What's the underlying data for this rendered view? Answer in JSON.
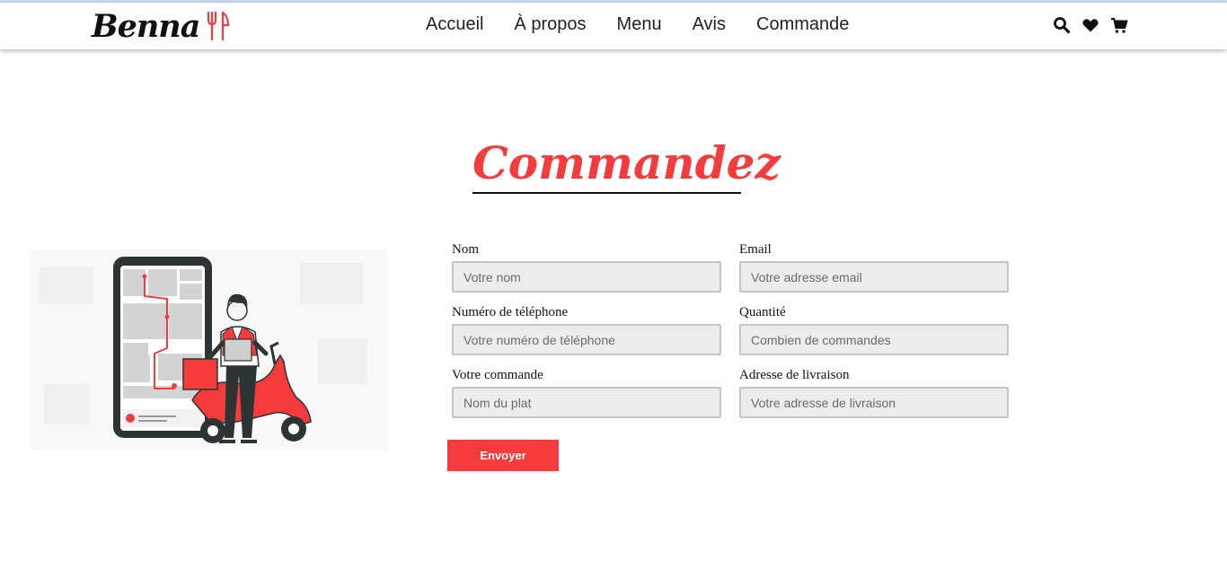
{
  "brand": {
    "name": "Benna",
    "logo_icon": "utensils-icon",
    "accent_color": "#f53b3b"
  },
  "nav": {
    "items": [
      {
        "label": "Accueil"
      },
      {
        "label": "À propos"
      },
      {
        "label": "Menu"
      },
      {
        "label": "Avis"
      },
      {
        "label": "Commande"
      }
    ],
    "icons": [
      "search-icon",
      "heart-icon",
      "cart-icon"
    ]
  },
  "section": {
    "title": "Commandez"
  },
  "illustration": {
    "icon": "delivery-scooter-illustration"
  },
  "form": {
    "fields": [
      {
        "label": "Nom",
        "placeholder": "Votre nom"
      },
      {
        "label": "Email",
        "placeholder": "Votre adresse email"
      },
      {
        "label": "Numéro de téléphone",
        "placeholder": "Votre numéro de téléphone"
      },
      {
        "label": "Quantité",
        "placeholder": "Combien de commandes"
      },
      {
        "label": "Votre commande",
        "placeholder": "Nom du plat"
      },
      {
        "label": "Adresse de livraison",
        "placeholder": "Votre adresse de livraison"
      }
    ],
    "submit_label": "Envoyer"
  }
}
